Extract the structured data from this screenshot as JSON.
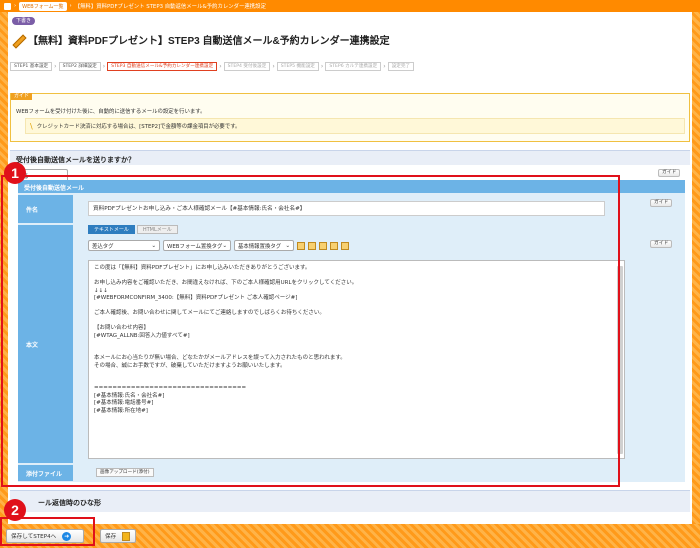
{
  "topbar": {
    "crumb_home": "WEBフォーム一覧",
    "crumb_current": "【無料】資料PDFプレゼント STEP3 自動返信メール&予約カレンダー連携設定"
  },
  "back_label": "下書き",
  "page_title": "【無料】資料PDFプレゼント】STEP3 自動送信メール&予約カレンダー連携設定",
  "steps": [
    {
      "label": "STEP1 基本設定",
      "state": "done"
    },
    {
      "label": "STEP2 詳細設定",
      "state": "done"
    },
    {
      "label": "STEP3 自動送信メール&予約カレンダー連携設定",
      "state": "active"
    },
    {
      "label": "STEP4 受付後設定",
      "state": "todo"
    },
    {
      "label": "STEP5 機能設定",
      "state": "todo"
    },
    {
      "label": "STEP6 カルテ連携設定",
      "state": "todo"
    },
    {
      "label": "設定完了",
      "state": "todo"
    }
  ],
  "guide": {
    "tab": "ガイド",
    "text": "WEBフォームを受け付けた後に、自動的に送信するメールの設定を行います。",
    "note": "クレジットカード決済に対応する場合は、[STEP2]で金額等の課金項目が必要です。"
  },
  "question": {
    "title": "受付後自動送信メールを送りますか？",
    "select_value": "送る",
    "guide_btn": "ガイド"
  },
  "panel": {
    "head": "受付後自動送信メール",
    "subject_label": "件名",
    "subject_value": "資料PDFプレゼントお申し込み・ご本人様確認メール【#基本情報:氏名・会社名#】",
    "body_label": "本文",
    "tab_text": "テキストメール",
    "tab_html": "HTMLメール",
    "tools": [
      "差込タグ",
      "WEBフォーム置換タグ",
      "基本情報置換タグ"
    ],
    "body_lines": [
      "この度は「【無料】資料PDFプレゼント」にお申し込みいただきありがとうございます。",
      "",
      "お申し込み内容をご確認いただき、お間違えなければ、下のご本人様確認用URLをクリックしてください。",
      "↓↓↓",
      "[#WEBFORMCONFIRM_3400:【無料】資料PDFプレゼント ご本人確認ページ#]",
      "",
      "ご本人確認後、お問い合わせに関してメールにてご連絡しますのでしばらくお待ちください。",
      "",
      "【お問い合わせ内容】",
      "[#WTAG_ALLNB:回答入力値すべて#]",
      "",
      "",
      "本メールにお心当たりが無い場合、どなたかがメールアドレスを誤って入力されたものと思われます。",
      "その場合、誠にお手数ですが、破棄していただけますようお願いいたします。",
      "",
      "",
      "=================================",
      "[#基本情報:氏名・会社名#]",
      "[#基本情報:電話番号#]",
      "[#基本情報:所在地#]"
    ],
    "attach_label": "添付ファイル",
    "attach_btn": "画像アップロード(添付)",
    "guide_btn": "ガイド"
  },
  "lower_title": "ール返信時のひな形",
  "footer": {
    "save_next": "保存してSTEP4へ",
    "save": "保存"
  },
  "badges": [
    "1",
    "2"
  ]
}
